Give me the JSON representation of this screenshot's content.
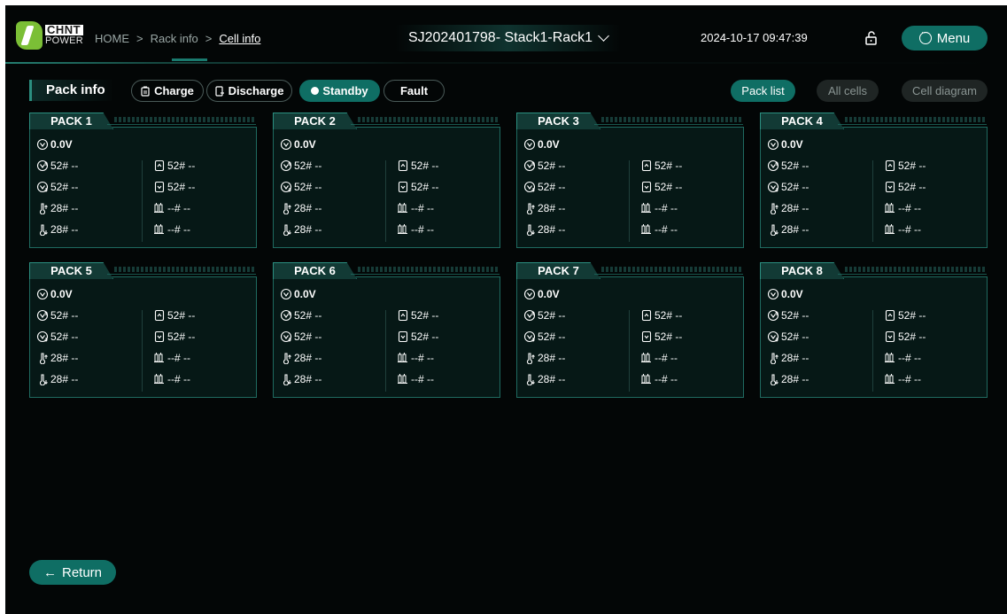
{
  "header": {
    "logo_top": "CHNT",
    "logo_bottom": "POWER",
    "breadcrumb": [
      "HOME",
      "Rack info",
      "Cell info"
    ],
    "title": "SJ202401798- Stack1-Rack1",
    "datetime": "2024-10-17 09:47:39",
    "menu_label": "Menu"
  },
  "toolbar": {
    "pack_info_label": "Pack info",
    "tabs": [
      {
        "label": "Charge",
        "icon": "battery-charge-icon",
        "active": false
      },
      {
        "label": "Discharge",
        "icon": "battery-discharge-icon",
        "active": false
      },
      {
        "label": "Standby",
        "icon": "dot-icon",
        "active": true
      },
      {
        "label": "Fault",
        "icon": "",
        "active": false
      }
    ],
    "views": [
      {
        "label": "Pack list",
        "active": true
      },
      {
        "label": "All cells",
        "active": false
      },
      {
        "label": "Cell diagram",
        "active": false
      }
    ]
  },
  "packs": [
    {
      "name": "PACK 1",
      "voltage": "0.0V",
      "vmax": "52# --",
      "vmin": "52# --",
      "tmax": "28# --",
      "tmin": "28# --",
      "soc_max": "52# --",
      "soc_min": "52# --",
      "bal1": "--# --",
      "bal2": "--# --"
    },
    {
      "name": "PACK 2",
      "voltage": "0.0V",
      "vmax": "52# --",
      "vmin": "52# --",
      "tmax": "28# --",
      "tmin": "28# --",
      "soc_max": "52# --",
      "soc_min": "52# --",
      "bal1": "--# --",
      "bal2": "--# --"
    },
    {
      "name": "PACK 3",
      "voltage": "0.0V",
      "vmax": "52# --",
      "vmin": "52# --",
      "tmax": "28# --",
      "tmin": "28# --",
      "soc_max": "52# --",
      "soc_min": "52# --",
      "bal1": "--# --",
      "bal2": "--# --"
    },
    {
      "name": "PACK 4",
      "voltage": "0.0V",
      "vmax": "52# --",
      "vmin": "52# --",
      "tmax": "28# --",
      "tmin": "28# --",
      "soc_max": "52# --",
      "soc_min": "52# --",
      "bal1": "--# --",
      "bal2": "--# --"
    },
    {
      "name": "PACK 5",
      "voltage": "0.0V",
      "vmax": "52# --",
      "vmin": "52# --",
      "tmax": "28# --",
      "tmin": "28# --",
      "soc_max": "52# --",
      "soc_min": "52# --",
      "bal1": "--# --",
      "bal2": "--# --"
    },
    {
      "name": "PACK 6",
      "voltage": "0.0V",
      "vmax": "52# --",
      "vmin": "52# --",
      "tmax": "28# --",
      "tmin": "28# --",
      "soc_max": "52# --",
      "soc_min": "52# --",
      "bal1": "--# --",
      "bal2": "--# --"
    },
    {
      "name": "PACK 7",
      "voltage": "0.0V",
      "vmax": "52# --",
      "vmin": "52# --",
      "tmax": "28# --",
      "tmin": "28# --",
      "soc_max": "52# --",
      "soc_min": "52# --",
      "bal1": "--# --",
      "bal2": "--# --"
    },
    {
      "name": "PACK 8",
      "voltage": "0.0V",
      "vmax": "52# --",
      "vmin": "52# --",
      "tmax": "28# --",
      "tmin": "28# --",
      "soc_max": "52# --",
      "soc_min": "52# --",
      "bal1": "--# --",
      "bal2": "--# --"
    }
  ],
  "footer": {
    "return_label": "Return"
  },
  "colors": {
    "accent": "#0f6e64",
    "border": "#1f6a60",
    "background": "#030606"
  }
}
